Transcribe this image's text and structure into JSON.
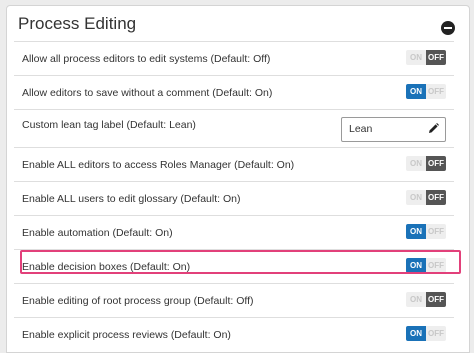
{
  "panel": {
    "title": "Process Editing",
    "collapse_icon": "minus-circle-icon"
  },
  "settings": [
    {
      "label": "Allow all process editors to edit systems (Default: Off)",
      "state": "off"
    },
    {
      "label": "Allow editors to save without a comment (Default: On)",
      "state": "on"
    },
    {
      "label": "Custom lean tag label (Default: Lean)",
      "type": "text",
      "value": "Lean",
      "icon": "pencil-icon"
    },
    {
      "label": "Enable ALL editors to access Roles Manager (Default: On)",
      "state": "off"
    },
    {
      "label": "Enable ALL users to edit glossary (Default: On)",
      "state": "off"
    },
    {
      "label": "Enable automation (Default: On)",
      "state": "on"
    },
    {
      "label": "Enable decision boxes (Default: On)",
      "state": "on",
      "highlighted": true
    },
    {
      "label": "Enable editing of root process group (Default: Off)",
      "state": "off"
    },
    {
      "label": "Enable explicit process reviews (Default: On)",
      "state": "on"
    }
  ],
  "toggle_labels": {
    "on": "ON",
    "off": "OFF"
  },
  "colors": {
    "on_accent": "#1a72b8",
    "off_dark": "#555555",
    "highlight": "#e2407a"
  }
}
